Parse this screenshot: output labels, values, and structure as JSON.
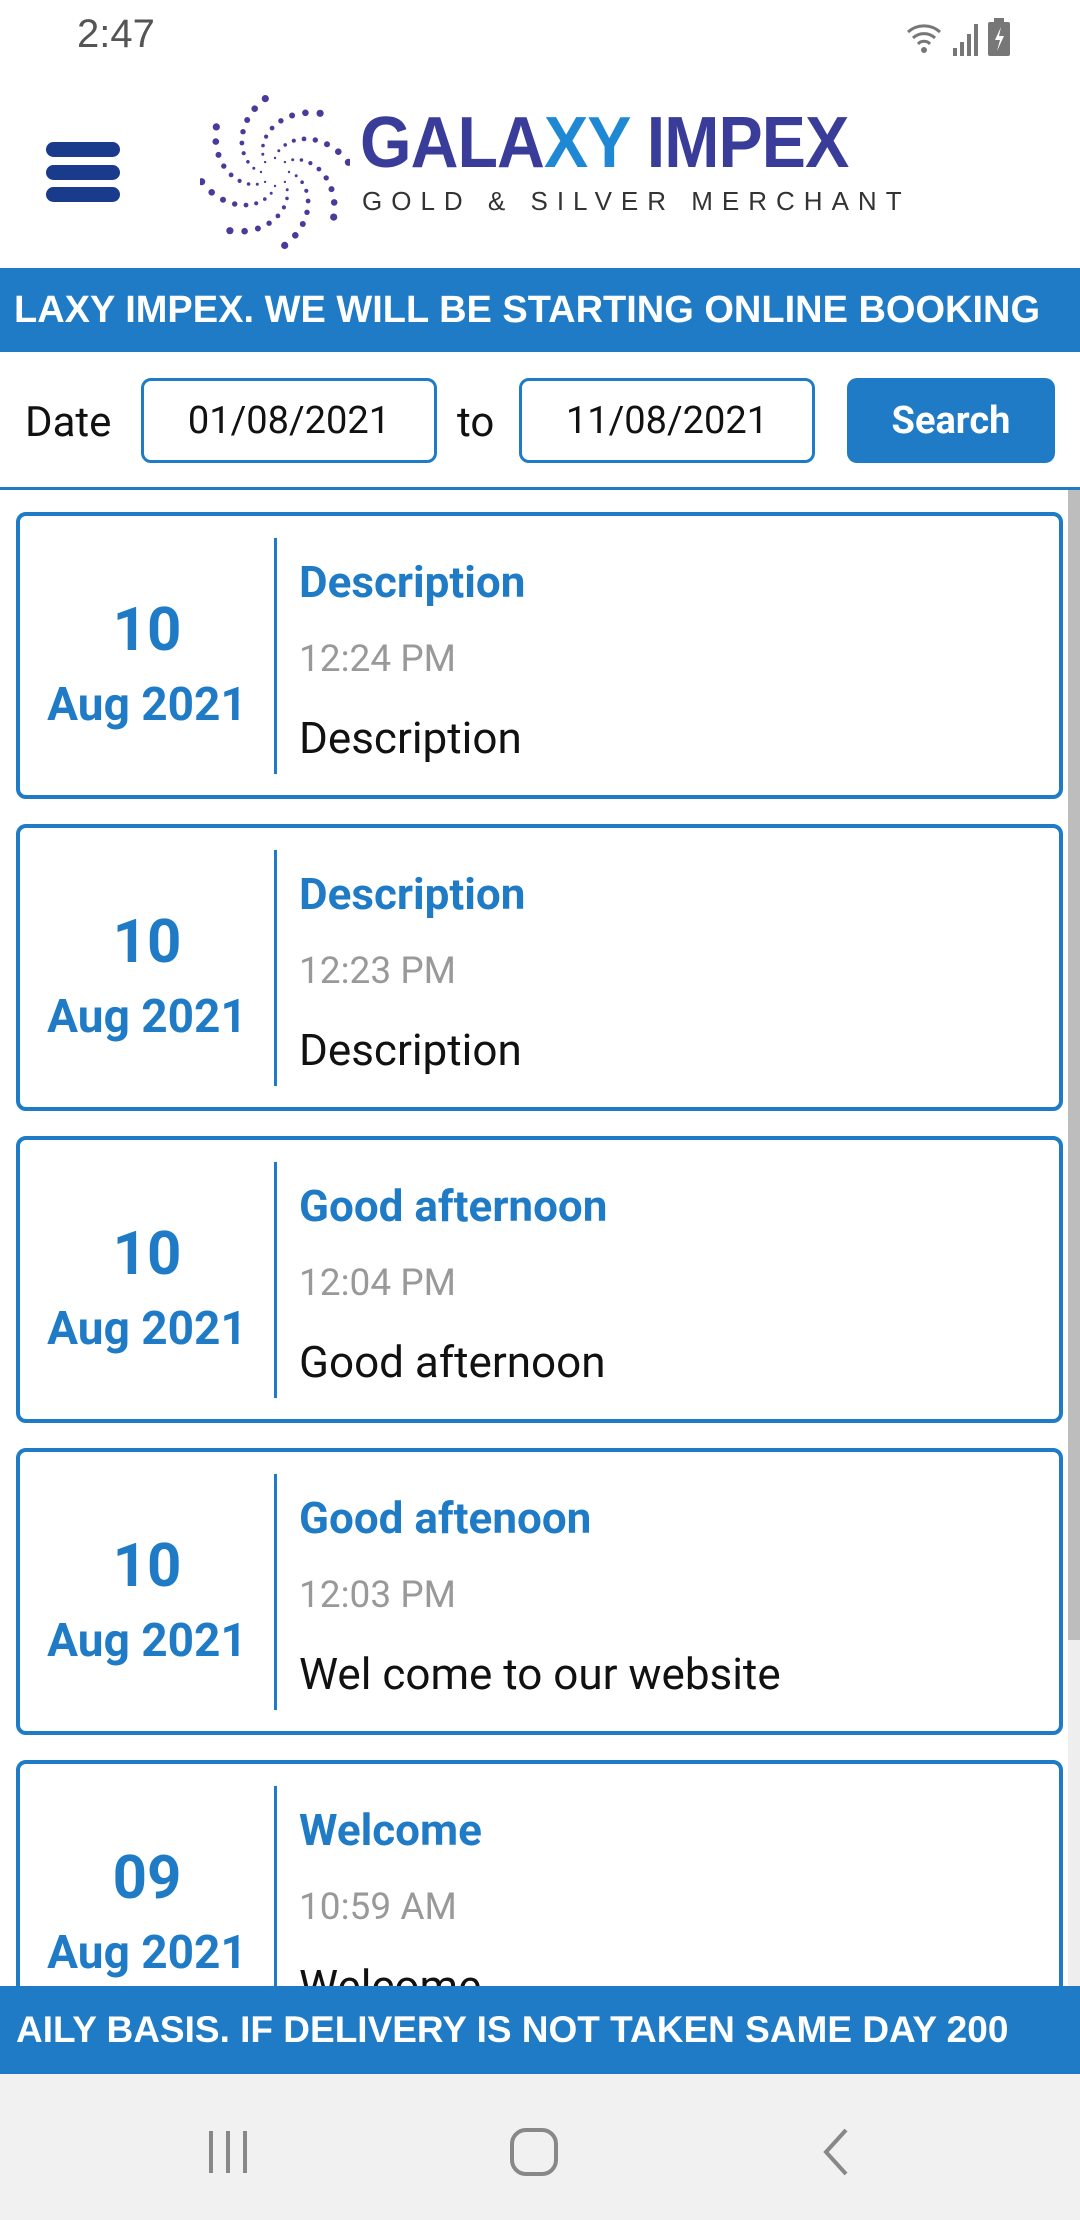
{
  "status_bar": {
    "time": "2:47",
    "icons": [
      "wifi-icon",
      "signal-icon",
      "battery-charging-icon"
    ]
  },
  "header": {
    "brand_part1": "GALA",
    "brand_part2": "XY",
    "brand_part3": " IMPEX",
    "tagline": "GOLD & SILVER MERCHANT",
    "menu_icon": "hamburger-icon"
  },
  "marquee_top": "LAXY IMPEX. WE WILL BE STARTING ONLINE BOOKING",
  "filter": {
    "date_label": "Date",
    "from": "01/08/2021",
    "to_label": "to",
    "to": "11/08/2021",
    "search_label": "Search"
  },
  "notices": [
    {
      "day": "10",
      "month_year": "Aug 2021",
      "title": "Description",
      "time": "12:24 PM",
      "description": "Description"
    },
    {
      "day": "10",
      "month_year": "Aug 2021",
      "title": "Description",
      "time": "12:23 PM",
      "description": "Description"
    },
    {
      "day": "10",
      "month_year": "Aug 2021",
      "title": "Good afternoon",
      "time": "12:04 PM",
      "description": "Good afternoon"
    },
    {
      "day": "10",
      "month_year": "Aug 2021",
      "title": "Good aftenoon",
      "time": "12:03 PM",
      "description": "Wel come to our website"
    },
    {
      "day": "09",
      "month_year": "Aug 2021",
      "title": "Welcome",
      "time": "10:59 AM",
      "description": "Welcome"
    }
  ],
  "marquee_bottom": "AILY BASIS. IF DELIVERY IS NOT TAKEN SAME DAY 200",
  "colors": {
    "accent": "#1f7bc6",
    "brand": "#3a3c9a"
  }
}
